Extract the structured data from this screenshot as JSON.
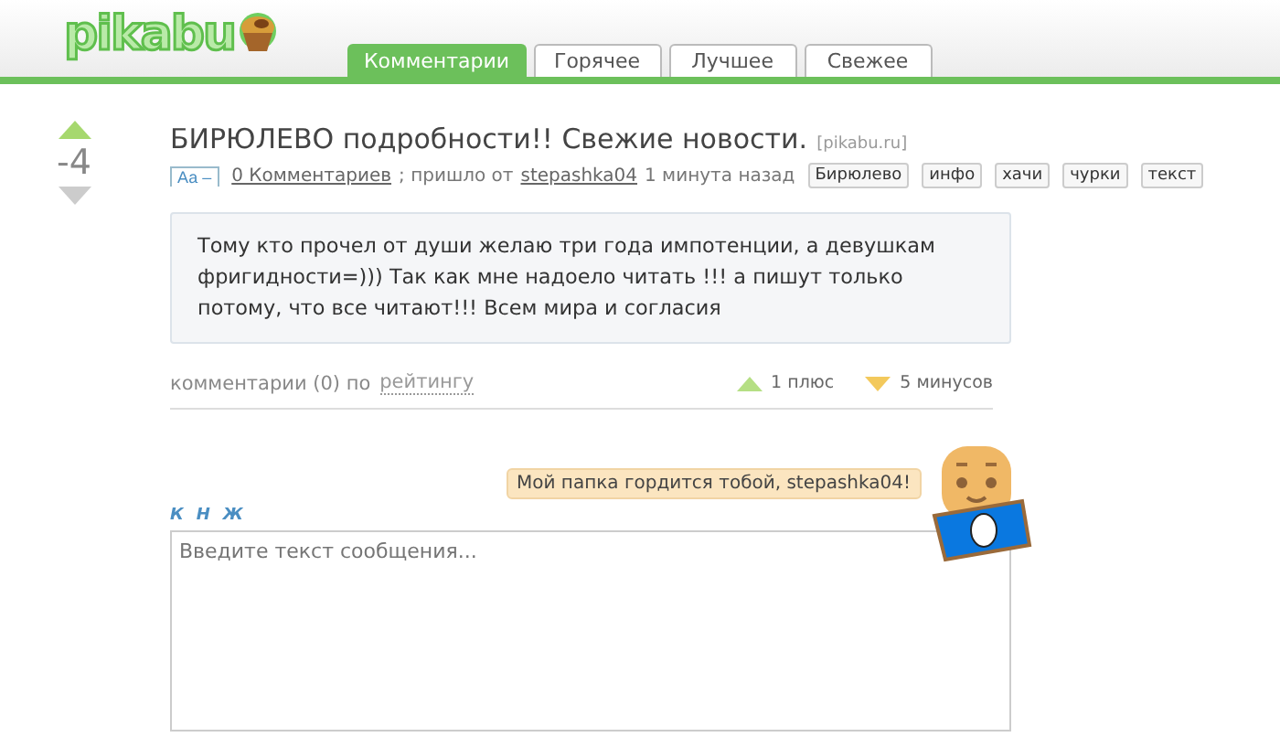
{
  "header": {
    "logo": "pikabu",
    "tabs": [
      {
        "label": "Комментарии",
        "selected": true
      },
      {
        "label": "Горячее",
        "selected": false
      },
      {
        "label": "Лучшее",
        "selected": false
      },
      {
        "label": "Свежее",
        "selected": false
      }
    ]
  },
  "post": {
    "rating": "-4",
    "title": "БИРЮЛЕВО подробности!! Свежие новости.",
    "source": "[pikabu.ru]",
    "font_toggle": "Аа –",
    "comments_link": "0 Комментариев",
    "posted_by": "; пришло от",
    "author": "stepashka04",
    "time": "1 минута назад",
    "tags": [
      "Бирюлево",
      "инфо",
      "хачи",
      "чурки",
      "текст"
    ],
    "body": "Тому кто прочел от души желаю три года импотенции, а девушкам фригидности=))) Так как мне надоело читать !!! а пишут только потому, что все читают!!! Всем мира и согласия"
  },
  "comments_bar": {
    "label": "комментарии (0) по",
    "sort": "рейтингу",
    "plus": "1 плюс",
    "minus": "5 минусов"
  },
  "reply": {
    "speech": "Мой папка гордится тобой, stepashka04!",
    "format_buttons": [
      "К",
      "Н",
      "Ж"
    ],
    "placeholder": "Введите текст сообщения..."
  }
}
